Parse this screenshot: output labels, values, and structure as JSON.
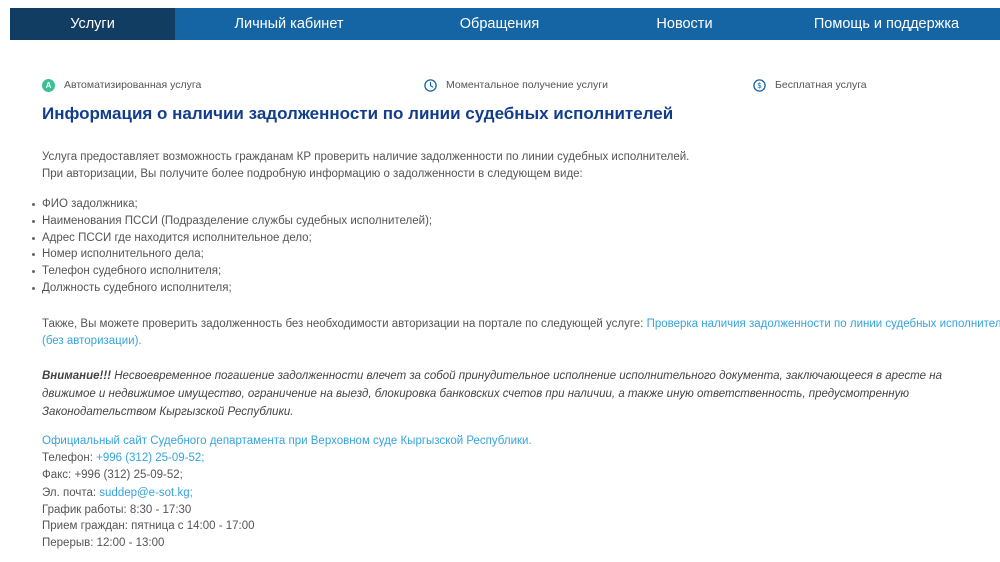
{
  "nav": {
    "tabs": [
      {
        "label": "Услуги",
        "active": true
      },
      {
        "label": "Личный кабинет",
        "active": false
      },
      {
        "label": "Обращения",
        "active": false
      },
      {
        "label": "Новости",
        "active": false
      },
      {
        "label": "Помощь и поддержка",
        "active": false
      }
    ]
  },
  "features": {
    "automated": {
      "label": "Автоматизированная услуга",
      "icon_letter": "A"
    },
    "instant": {
      "label": "Моментальное получение услуги"
    },
    "free": {
      "label": "Бесплатная услуга"
    }
  },
  "service": {
    "title": "Информация о наличии задолженности по линии судебных исполнителей",
    "intro_1": "Услуга предоставляет возможность гражданам КР проверить наличие задолженности по линии судебных исполнителей.",
    "intro_2": "При авторизации, Вы получите более подробную информацию о задолженности в следующем виде:",
    "items": [
      "ФИО задолжника;",
      "Наименования ПССИ (Подразделение службы судебных исполнителей);",
      "Адрес ПССИ где находится исполнительное дело;",
      "Номер исполнительного дела;",
      "Телефон судебного исполнителя;",
      "Должность судебного исполнителя;"
    ],
    "also_text": "Также, Вы можете проверить задолженность без необходимости авторизации на портале по следующей услуге: ",
    "also_link_1": "Проверка наличия задолженности по линии судебных исполнителей",
    "also_link_2": "(без авторизации).",
    "warning_bold": "Внимание!!!",
    "warning_text": " Несвоевременное погашение задолженности влечет за собой принудительное исполнение исполнительного документа, заключающееся в аресте на движимое и недвижимое имущество, ограничение на выезд, блокировка банковских счетов при наличии, а также иную ответственность, предусмотренную Законодательством Кыргызской Республики."
  },
  "contacts": {
    "official_link": "Официальный сайт Судебного департамента при Верховном суде Кыргызской Республики.",
    "phone_label": "Телефон: ",
    "phone_value": "+996 (312) 25-09-52;",
    "fax": "Факс: +996 (312) 25-09-52;",
    "email_label": "Эл. почта: ",
    "email_value": "suddep@e-sot.kg;",
    "schedule": "График работы: 8:30 - 17:30",
    "reception": "Прием граждан: пятница с 14:00 - 17:00",
    "break": "Перерыв: 12:00 - 13:00"
  },
  "colors": {
    "nav_bg": "#1565a5",
    "nav_active_bg": "#123d63",
    "title": "#123d8c",
    "link": "#36a3dd",
    "badge_green": "#3bbf97"
  }
}
